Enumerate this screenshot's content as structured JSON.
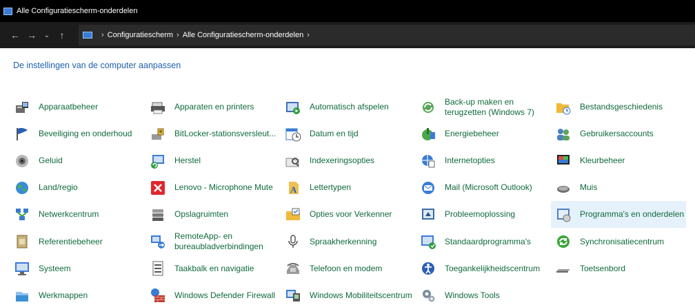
{
  "window": {
    "title": "Alle Configuratiescherm-onderdelen"
  },
  "nav": {
    "back": "←",
    "forward": "→",
    "recent": "⌄",
    "up": "↑"
  },
  "breadcrumb": {
    "sep1": "›",
    "item1": "Configuratiescherm",
    "sep2": "›",
    "item2": "Alle Configuratiescherm-onderdelen",
    "sep3": "›"
  },
  "heading": "De instellingen van de computer aanpassen",
  "colors": {
    "link": "#0f6a3c",
    "heading": "#1f5fb0",
    "hover": "#e5f1fb",
    "titlebar": "#000000",
    "addressbar": "#1c1c1c"
  },
  "items": [
    {
      "label": "Apparaatbeheer",
      "icon": "device-manager-icon"
    },
    {
      "label": "Apparaten en printers",
      "icon": "printer-icon"
    },
    {
      "label": "Automatisch afspelen",
      "icon": "autoplay-icon"
    },
    {
      "label": "Back-up maken en terugzetten (Windows 7)",
      "icon": "backup-icon"
    },
    {
      "label": "Bestandsgeschiedenis",
      "icon": "file-history-icon"
    },
    {
      "label": "Beveiliging en onderhoud",
      "icon": "flag-icon"
    },
    {
      "label": "BitLocker-stationsversleut...",
      "icon": "bitlocker-icon"
    },
    {
      "label": "Datum en tijd",
      "icon": "calendar-clock-icon"
    },
    {
      "label": "Energiebeheer",
      "icon": "power-icon"
    },
    {
      "label": "Gebruikersaccounts",
      "icon": "users-icon"
    },
    {
      "label": "Geluid",
      "icon": "speaker-icon"
    },
    {
      "label": "Herstel",
      "icon": "recovery-icon"
    },
    {
      "label": "Indexeringsopties",
      "icon": "indexing-icon"
    },
    {
      "label": "Internetopties",
      "icon": "internet-options-icon"
    },
    {
      "label": "Kleurbeheer",
      "icon": "color-management-icon"
    },
    {
      "label": "Land/regio",
      "icon": "globe-icon"
    },
    {
      "label": "Lenovo - Microphone Mute",
      "icon": "mic-mute-icon"
    },
    {
      "label": "Lettertypen",
      "icon": "fonts-icon"
    },
    {
      "label": "Mail (Microsoft Outlook)",
      "icon": "mail-icon"
    },
    {
      "label": "Muis",
      "icon": "mouse-icon"
    },
    {
      "label": "Netwerkcentrum",
      "icon": "network-icon"
    },
    {
      "label": "Opslagruimten",
      "icon": "storage-icon"
    },
    {
      "label": "Opties voor Verkenner",
      "icon": "folder-options-icon"
    },
    {
      "label": "Probleemoplossing",
      "icon": "troubleshoot-icon"
    },
    {
      "label": "Programma's en onderdelen",
      "icon": "programs-icon"
    },
    {
      "label": "Referentiebeheer",
      "icon": "credential-icon"
    },
    {
      "label": "RemoteApp- en bureaubladverbindingen",
      "icon": "remoteapp-icon"
    },
    {
      "label": "Spraakherkenning",
      "icon": "microphone-icon"
    },
    {
      "label": "Standaardprogramma's",
      "icon": "default-programs-icon"
    },
    {
      "label": "Synchronisatiecentrum",
      "icon": "sync-icon"
    },
    {
      "label": "Systeem",
      "icon": "system-icon"
    },
    {
      "label": "Taakbalk en navigatie",
      "icon": "taskbar-icon"
    },
    {
      "label": "Telefoon en modem",
      "icon": "phone-icon"
    },
    {
      "label": "Toegankelijkheidscentrum",
      "icon": "accessibility-icon"
    },
    {
      "label": "Toetsenbord",
      "icon": "keyboard-icon"
    },
    {
      "label": "Werkmappen",
      "icon": "work-folders-icon"
    },
    {
      "label": "Windows Defender Firewall",
      "icon": "firewall-icon"
    },
    {
      "label": "Windows Mobiliteitscentrum",
      "icon": "mobility-icon"
    },
    {
      "label": "Windows Tools",
      "icon": "tools-icon"
    },
    {
      "label": "",
      "icon": ""
    }
  ],
  "hover_index": 24
}
